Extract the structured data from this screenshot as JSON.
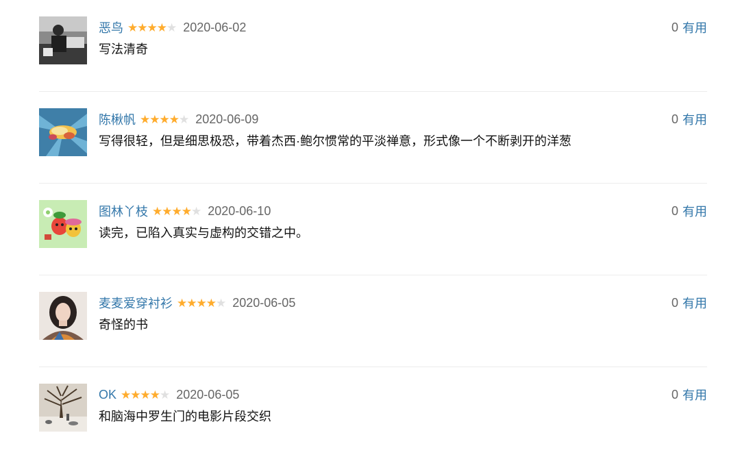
{
  "comments": [
    {
      "user": "恶鸟",
      "rating": 4,
      "date": "2020-06-02",
      "text": "写法清奇",
      "votes": "0",
      "vote_label": "有用",
      "avatar": "bw-photo"
    },
    {
      "user": "陈楸帆",
      "rating": 4,
      "date": "2020-06-09",
      "text": "写得很轻，但是细思极恐，带着杰西·鲍尔惯常的平淡禅意，形式像一个不断剥开的洋葱",
      "votes": "0",
      "vote_label": "有用",
      "avatar": "burst-art"
    },
    {
      "user": "图林丫枝",
      "rating": 4,
      "date": "2020-06-10",
      "text": "读完，已陷入真实与虚构的交错之中。",
      "votes": "0",
      "vote_label": "有用",
      "avatar": "cartoon"
    },
    {
      "user": "麦麦爱穿衬衫",
      "rating": 4,
      "date": "2020-06-05",
      "text": "奇怪的书",
      "votes": "0",
      "vote_label": "有用",
      "avatar": "portrait"
    },
    {
      "user": "OK",
      "rating": 4,
      "date": "2020-06-05",
      "text": "和脑海中罗生门的电影片段交织",
      "votes": "0",
      "vote_label": "有用",
      "avatar": "winter-tree"
    }
  ],
  "colors": {
    "link": "#3377aa",
    "star_on": "#ffac2d",
    "star_off": "#e0e0e0",
    "muted": "#666666"
  }
}
